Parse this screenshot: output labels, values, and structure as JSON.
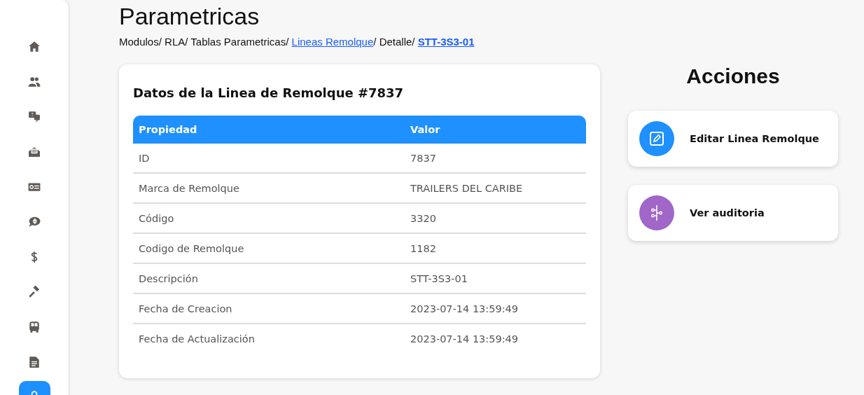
{
  "sidebar": {
    "items": [
      {
        "selected": false
      },
      {
        "selected": false
      },
      {
        "selected": false
      },
      {
        "selected": false
      },
      {
        "selected": false
      },
      {
        "selected": false
      },
      {
        "selected": false
      },
      {
        "selected": false
      },
      {
        "selected": false
      },
      {
        "selected": false
      },
      {
        "selected": true
      }
    ]
  },
  "page_title": "Parametricas",
  "breadcrumb": [
    {
      "label": "Modulos",
      "kind": "text",
      "separator": "/"
    },
    {
      "label": "RLA",
      "kind": "text",
      "separator": "/"
    },
    {
      "label": "Tablas Parametricas",
      "kind": "text",
      "separator": "/"
    },
    {
      "label": "Lineas Remolque",
      "kind": "link",
      "separator": "/"
    },
    {
      "label": "Detalle",
      "kind": "text",
      "separator": "/"
    },
    {
      "label": "STT-3S3-01",
      "kind": "current"
    }
  ],
  "detail_card": {
    "title": "Datos de la Linea de Remolque #7837",
    "columns": [
      "Propiedad",
      "Valor"
    ],
    "rows": [
      [
        "ID",
        "7837"
      ],
      [
        "Marca de Remolque",
        "TRAILERS DEL CARIBE"
      ],
      [
        "Código",
        "3320"
      ],
      [
        "Codigo de Remolque",
        "1182"
      ],
      [
        "Descripción",
        "STT-3S3-01"
      ],
      [
        "Fecha de Creacion",
        "2023-07-14 13:59:49"
      ],
      [
        "Fecha de Actualización",
        "2023-07-14 13:59:49"
      ]
    ]
  },
  "actions": {
    "title": "Acciones",
    "items": [
      {
        "label": "Editar Linea Remolque",
        "kind": "edit",
        "color": "#1e90ff"
      },
      {
        "label": "Ver auditoria",
        "kind": "audit",
        "color": "#a066c8"
      }
    ]
  }
}
